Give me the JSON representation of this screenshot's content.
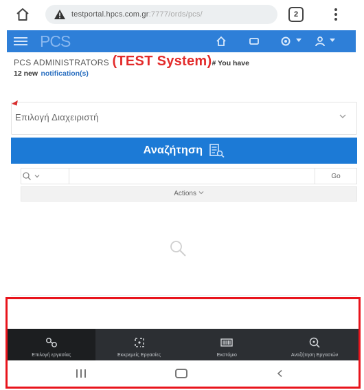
{
  "browser": {
    "url_main": "testportal.hpcs.com.gr",
    "url_rest": ":7777/ords/pcs/",
    "tab_count": "2"
  },
  "navbar": {
    "brand": "PCS"
  },
  "header": {
    "admin_label": "PCS ADMINISTRATORS",
    "test_label": "(TEST System)",
    "notif_prefix": "# You have",
    "notif_count_text": "12 new",
    "notif_link": "notification(s)"
  },
  "filters": {
    "select_placeholder": "Επιλογή Διαχειριστή",
    "search_button": "Αναζήτηση",
    "go_button": "Go",
    "actions_label": "Actions"
  },
  "bottom_nav": {
    "items": [
      {
        "label": "Επιλογή εργασίας",
        "icon": "link-chain-icon"
      },
      {
        "label": "Εκκρεμείς Εργασίες",
        "icon": "pending-tasks-icon"
      },
      {
        "label": "Εκστόμιο",
        "icon": "barcode-icon"
      },
      {
        "label": "Αναζήτηση Εργασιών",
        "icon": "search-tasks-icon"
      }
    ]
  },
  "colors": {
    "navbar": "#2e7fd8",
    "search_button": "#1c7ad6",
    "test_label": "#e32b2b",
    "highlight": "#e8141c",
    "bottom_nav": "#2c2f33"
  }
}
